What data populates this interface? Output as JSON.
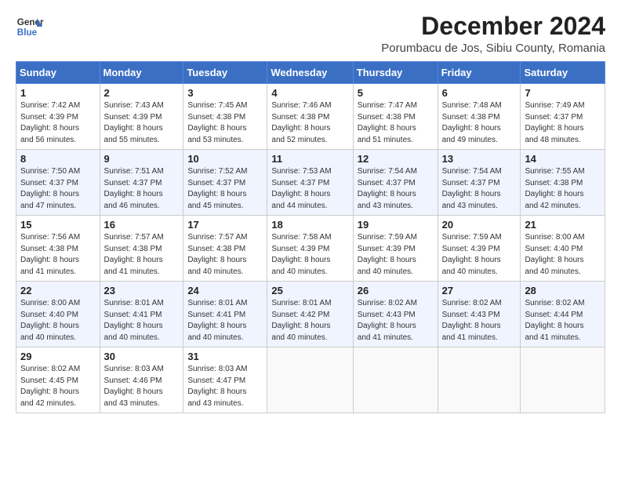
{
  "header": {
    "logo_line1": "General",
    "logo_line2": "Blue",
    "month": "December 2024",
    "location": "Porumbacu de Jos, Sibiu County, Romania"
  },
  "days_of_week": [
    "Sunday",
    "Monday",
    "Tuesday",
    "Wednesday",
    "Thursday",
    "Friday",
    "Saturday"
  ],
  "weeks": [
    [
      {
        "day": "1",
        "info": "Sunrise: 7:42 AM\nSunset: 4:39 PM\nDaylight: 8 hours\nand 56 minutes."
      },
      {
        "day": "2",
        "info": "Sunrise: 7:43 AM\nSunset: 4:39 PM\nDaylight: 8 hours\nand 55 minutes."
      },
      {
        "day": "3",
        "info": "Sunrise: 7:45 AM\nSunset: 4:38 PM\nDaylight: 8 hours\nand 53 minutes."
      },
      {
        "day": "4",
        "info": "Sunrise: 7:46 AM\nSunset: 4:38 PM\nDaylight: 8 hours\nand 52 minutes."
      },
      {
        "day": "5",
        "info": "Sunrise: 7:47 AM\nSunset: 4:38 PM\nDaylight: 8 hours\nand 51 minutes."
      },
      {
        "day": "6",
        "info": "Sunrise: 7:48 AM\nSunset: 4:38 PM\nDaylight: 8 hours\nand 49 minutes."
      },
      {
        "day": "7",
        "info": "Sunrise: 7:49 AM\nSunset: 4:37 PM\nDaylight: 8 hours\nand 48 minutes."
      }
    ],
    [
      {
        "day": "8",
        "info": "Sunrise: 7:50 AM\nSunset: 4:37 PM\nDaylight: 8 hours\nand 47 minutes."
      },
      {
        "day": "9",
        "info": "Sunrise: 7:51 AM\nSunset: 4:37 PM\nDaylight: 8 hours\nand 46 minutes."
      },
      {
        "day": "10",
        "info": "Sunrise: 7:52 AM\nSunset: 4:37 PM\nDaylight: 8 hours\nand 45 minutes."
      },
      {
        "day": "11",
        "info": "Sunrise: 7:53 AM\nSunset: 4:37 PM\nDaylight: 8 hours\nand 44 minutes."
      },
      {
        "day": "12",
        "info": "Sunrise: 7:54 AM\nSunset: 4:37 PM\nDaylight: 8 hours\nand 43 minutes."
      },
      {
        "day": "13",
        "info": "Sunrise: 7:54 AM\nSunset: 4:37 PM\nDaylight: 8 hours\nand 43 minutes."
      },
      {
        "day": "14",
        "info": "Sunrise: 7:55 AM\nSunset: 4:38 PM\nDaylight: 8 hours\nand 42 minutes."
      }
    ],
    [
      {
        "day": "15",
        "info": "Sunrise: 7:56 AM\nSunset: 4:38 PM\nDaylight: 8 hours\nand 41 minutes."
      },
      {
        "day": "16",
        "info": "Sunrise: 7:57 AM\nSunset: 4:38 PM\nDaylight: 8 hours\nand 41 minutes."
      },
      {
        "day": "17",
        "info": "Sunrise: 7:57 AM\nSunset: 4:38 PM\nDaylight: 8 hours\nand 40 minutes."
      },
      {
        "day": "18",
        "info": "Sunrise: 7:58 AM\nSunset: 4:39 PM\nDaylight: 8 hours\nand 40 minutes."
      },
      {
        "day": "19",
        "info": "Sunrise: 7:59 AM\nSunset: 4:39 PM\nDaylight: 8 hours\nand 40 minutes."
      },
      {
        "day": "20",
        "info": "Sunrise: 7:59 AM\nSunset: 4:39 PM\nDaylight: 8 hours\nand 40 minutes."
      },
      {
        "day": "21",
        "info": "Sunrise: 8:00 AM\nSunset: 4:40 PM\nDaylight: 8 hours\nand 40 minutes."
      }
    ],
    [
      {
        "day": "22",
        "info": "Sunrise: 8:00 AM\nSunset: 4:40 PM\nDaylight: 8 hours\nand 40 minutes."
      },
      {
        "day": "23",
        "info": "Sunrise: 8:01 AM\nSunset: 4:41 PM\nDaylight: 8 hours\nand 40 minutes."
      },
      {
        "day": "24",
        "info": "Sunrise: 8:01 AM\nSunset: 4:41 PM\nDaylight: 8 hours\nand 40 minutes."
      },
      {
        "day": "25",
        "info": "Sunrise: 8:01 AM\nSunset: 4:42 PM\nDaylight: 8 hours\nand 40 minutes."
      },
      {
        "day": "26",
        "info": "Sunrise: 8:02 AM\nSunset: 4:43 PM\nDaylight: 8 hours\nand 41 minutes."
      },
      {
        "day": "27",
        "info": "Sunrise: 8:02 AM\nSunset: 4:43 PM\nDaylight: 8 hours\nand 41 minutes."
      },
      {
        "day": "28",
        "info": "Sunrise: 8:02 AM\nSunset: 4:44 PM\nDaylight: 8 hours\nand 41 minutes."
      }
    ],
    [
      {
        "day": "29",
        "info": "Sunrise: 8:02 AM\nSunset: 4:45 PM\nDaylight: 8 hours\nand 42 minutes."
      },
      {
        "day": "30",
        "info": "Sunrise: 8:03 AM\nSunset: 4:46 PM\nDaylight: 8 hours\nand 43 minutes."
      },
      {
        "day": "31",
        "info": "Sunrise: 8:03 AM\nSunset: 4:47 PM\nDaylight: 8 hours\nand 43 minutes."
      },
      {
        "day": "",
        "info": ""
      },
      {
        "day": "",
        "info": ""
      },
      {
        "day": "",
        "info": ""
      },
      {
        "day": "",
        "info": ""
      }
    ]
  ]
}
